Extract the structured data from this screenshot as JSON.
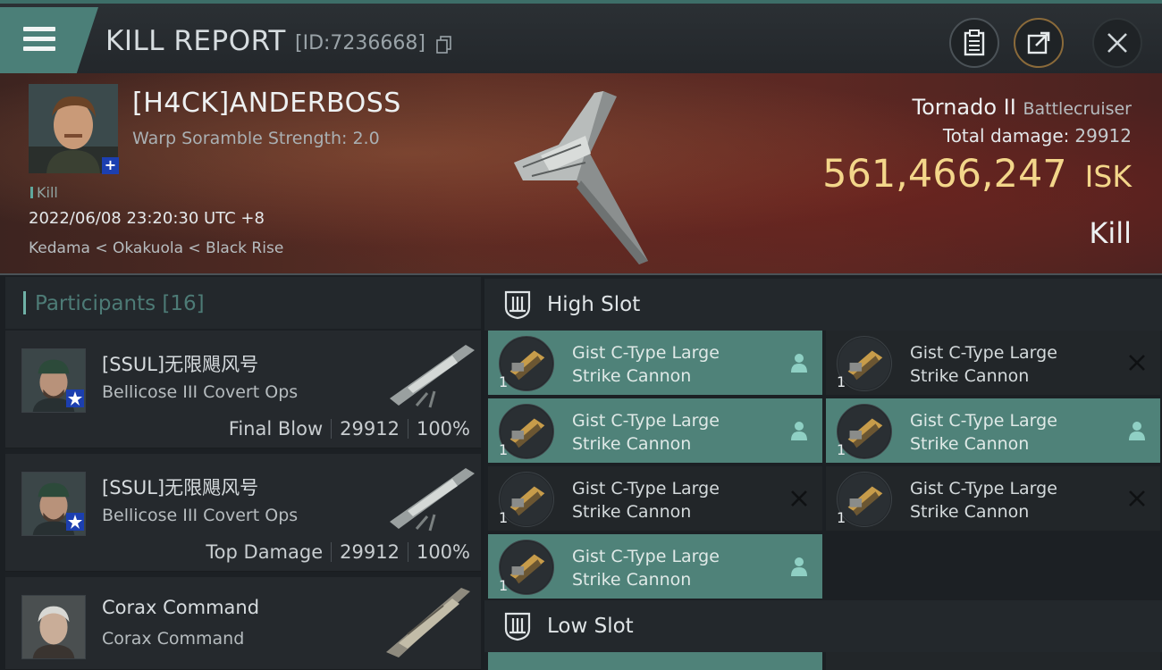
{
  "header": {
    "title": "KILL REPORT",
    "report_id": "[ID:7236668]",
    "menu_icon": "hamburger-menu-icon",
    "actions": [
      {
        "name": "clipboard-icon"
      },
      {
        "name": "share-icon"
      },
      {
        "name": "close-icon"
      }
    ]
  },
  "victim": {
    "name": "[H4CK]ANDERBOSS",
    "scramble": "Warp Soramble Strength: 2.0",
    "tag": "Kill",
    "datetime": "2022/06/08 23:20:30 UTC +8",
    "location": "Kedama < Okakuola < Black Rise",
    "ship_name": "Tornado II",
    "ship_class": "Battlecruiser",
    "total_damage_label": "Total damage:",
    "total_damage": "29912",
    "isk_value": "561,466,247",
    "isk_unit": "ISK",
    "result": "Kill"
  },
  "participants": {
    "title": "Participants [16]",
    "rows": [
      {
        "name": "[SSUL]无限飓风号",
        "ship": "Bellicose III Covert Ops",
        "role": "Final Blow",
        "damage": "29912",
        "percent": "100%"
      },
      {
        "name": "[SSUL]无限飓风号",
        "ship": "Bellicose III Covert Ops",
        "role": "Top Damage",
        "damage": "29912",
        "percent": "100%"
      },
      {
        "name": "Corax Command",
        "ship": "Corax Command",
        "role": "",
        "damage": "",
        "percent": ""
      }
    ]
  },
  "slots": {
    "high": {
      "title": "High Slot",
      "modules": [
        {
          "name_l1": "Gist C-Type Large",
          "name_l2": "Strike Cannon",
          "qty": "1",
          "status": "dropped"
        },
        {
          "name_l1": "Gist C-Type Large",
          "name_l2": "Strike Cannon",
          "qty": "1",
          "status": "destroyed"
        },
        {
          "name_l1": "Gist C-Type Large",
          "name_l2": "Strike Cannon",
          "qty": "1",
          "status": "dropped"
        },
        {
          "name_l1": "Gist C-Type Large",
          "name_l2": "Strike Cannon",
          "qty": "1",
          "status": "dropped"
        },
        {
          "name_l1": "Gist C-Type Large",
          "name_l2": "Strike Cannon",
          "qty": "1",
          "status": "destroyed"
        },
        {
          "name_l1": "Gist C-Type Large",
          "name_l2": "Strike Cannon",
          "qty": "1",
          "status": "destroyed"
        },
        {
          "name_l1": "Gist C-Type Large",
          "name_l2": "Strike Cannon",
          "qty": "1",
          "status": "dropped"
        }
      ]
    },
    "low": {
      "title": "Low Slot"
    }
  },
  "colors": {
    "accent": "#4f8279",
    "isk": "#f3d68a",
    "hero_bg": "#5a2d24"
  }
}
